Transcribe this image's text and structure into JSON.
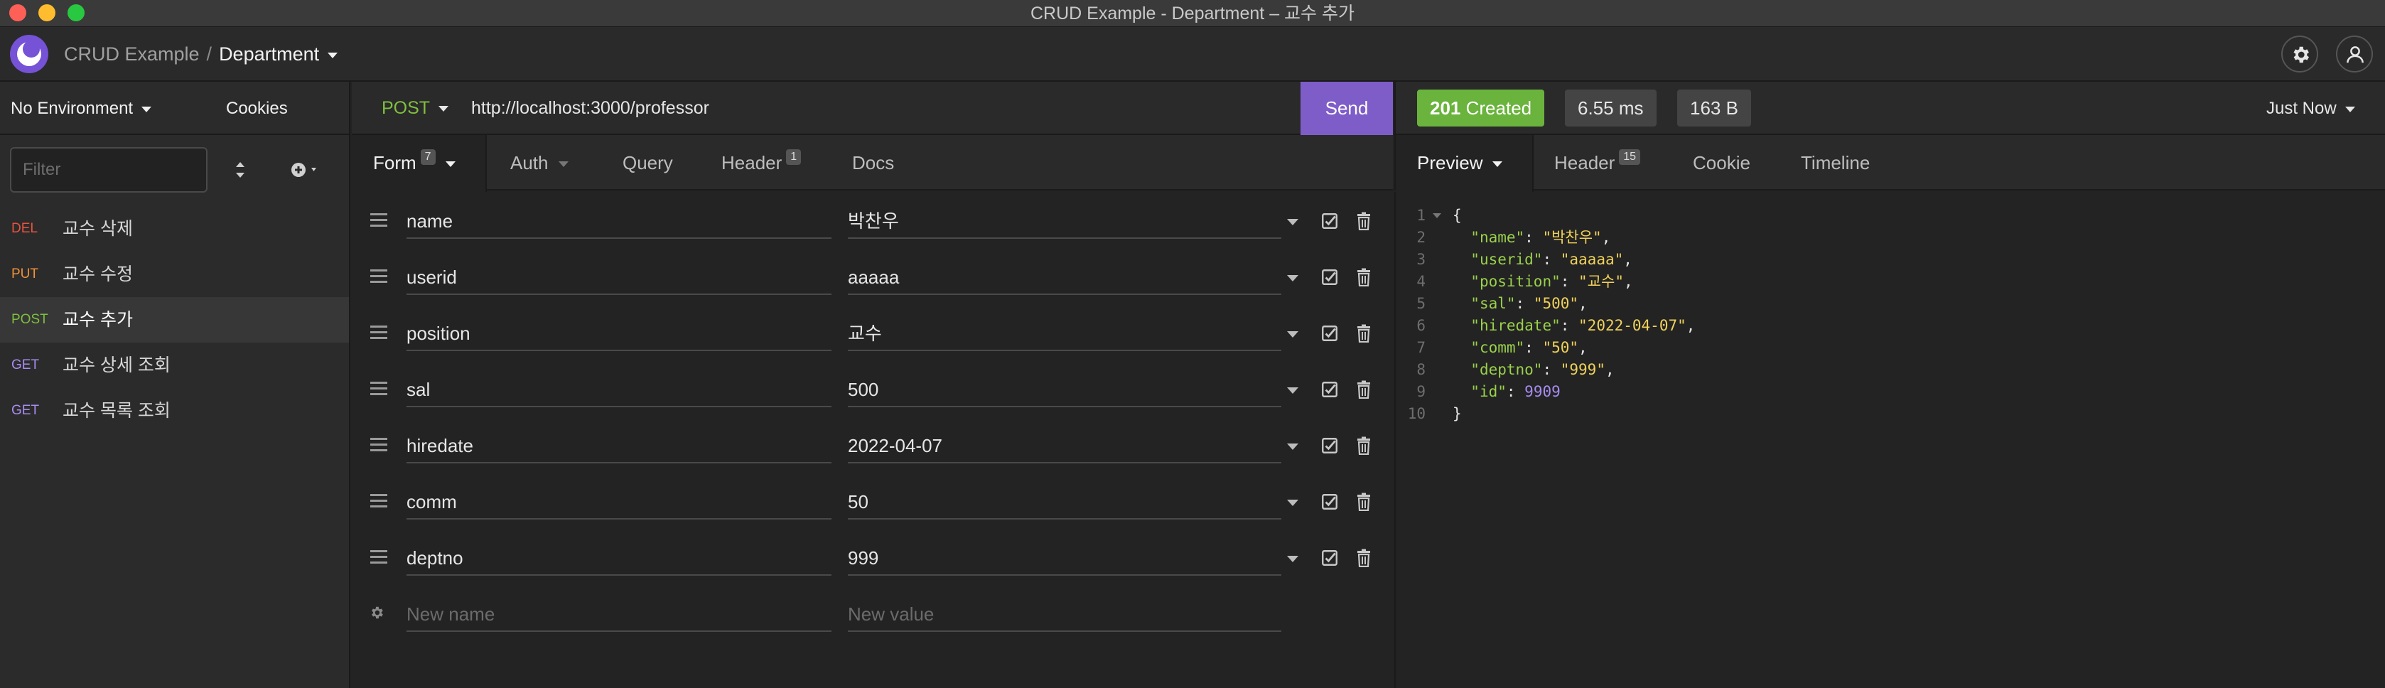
{
  "window": {
    "title": "CRUD Example - Department – 교수 추가"
  },
  "header": {
    "project": "CRUD Example",
    "separator": "/",
    "workspace": "Department"
  },
  "sidebar": {
    "environment": "No Environment",
    "cookies": "Cookies",
    "filter_placeholder": "Filter",
    "requests": [
      {
        "method": "DEL",
        "name": "교수 삭제",
        "color": "#e8533f",
        "active": false
      },
      {
        "method": "PUT",
        "name": "교수 수정",
        "color": "#f0923a",
        "active": false
      },
      {
        "method": "POST",
        "name": "교수 추가",
        "color": "#7fbf3f",
        "active": true
      },
      {
        "method": "GET",
        "name": "교수 상세 조회",
        "color": "#a88cf0",
        "active": false
      },
      {
        "method": "GET",
        "name": "교수 목록 조회",
        "color": "#a88cf0",
        "active": false
      }
    ]
  },
  "request": {
    "method": "POST",
    "url": "http://localhost:3000/professor",
    "send_label": "Send",
    "tabs": {
      "form": "Form",
      "form_count": "7",
      "auth": "Auth",
      "query": "Query",
      "header": "Header",
      "header_count": "1",
      "docs": "Docs"
    },
    "fields": [
      {
        "name": "name",
        "value": "박찬우"
      },
      {
        "name": "userid",
        "value": "aaaaa"
      },
      {
        "name": "position",
        "value": "교수"
      },
      {
        "name": "sal",
        "value": "500"
      },
      {
        "name": "hiredate",
        "value": "2022-04-07"
      },
      {
        "name": "comm",
        "value": "50"
      },
      {
        "name": "deptno",
        "value": "999"
      }
    ],
    "new_name_placeholder": "New name",
    "new_value_placeholder": "New value"
  },
  "response": {
    "status_code": "201",
    "status_text": "Created",
    "time": "6.55 ms",
    "size": "163 B",
    "timestamp": "Just Now",
    "tabs": {
      "preview": "Preview",
      "header": "Header",
      "header_count": "15",
      "cookie": "Cookie",
      "timeline": "Timeline"
    },
    "line_numbers": [
      "1",
      "2",
      "3",
      "4",
      "5",
      "6",
      "7",
      "8",
      "9",
      "10"
    ],
    "body": {
      "open": "{",
      "close": "}",
      "entries": [
        {
          "key": "\"name\"",
          "value": "\"박찬우\"",
          "type": "string",
          "comma": ","
        },
        {
          "key": "\"userid\"",
          "value": "\"aaaaa\"",
          "type": "string",
          "comma": ","
        },
        {
          "key": "\"position\"",
          "value": "\"교수\"",
          "type": "string",
          "comma": ","
        },
        {
          "key": "\"sal\"",
          "value": "\"500\"",
          "type": "string",
          "comma": ","
        },
        {
          "key": "\"hiredate\"",
          "value": "\"2022-04-07\"",
          "type": "string",
          "comma": ","
        },
        {
          "key": "\"comm\"",
          "value": "\"50\"",
          "type": "string",
          "comma": ","
        },
        {
          "key": "\"deptno\"",
          "value": "\"999\"",
          "type": "string",
          "comma": ","
        },
        {
          "key": "\"id\"",
          "value": "9909",
          "type": "number",
          "comma": ""
        }
      ]
    }
  },
  "colors": {
    "accent": "#7e5dc9",
    "status_ok": "#6ab33c",
    "post": "#7fbf3f"
  }
}
